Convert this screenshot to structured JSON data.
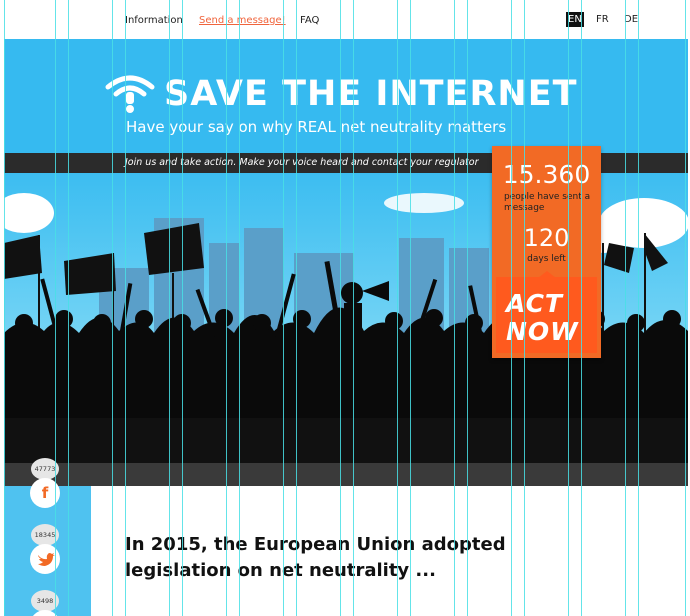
{
  "nav": {
    "info": "Information",
    "send": "Send a message!",
    "faq": "FAQ",
    "languages": [
      "EN",
      "FR",
      "DE"
    ]
  },
  "hero": {
    "title": "SAVE THE INTERNET",
    "subtitle": "Have your say on why REAL net neutrality matters",
    "strip": "Join us and take action. Make your voice heard and contact your regulator"
  },
  "counter": {
    "messages": "15.360",
    "messages_label": "people have sent a message",
    "days": "120",
    "days_label": "days left",
    "act_line1": "ACT",
    "act_line2": "NOW"
  },
  "share": [
    {
      "count": "47773",
      "icon": "facebook-icon",
      "letter": "f"
    },
    {
      "count": "18345",
      "icon": "twitter-icon"
    },
    {
      "count": "3498",
      "icon": "share-icon"
    }
  ],
  "content": {
    "headline": "In 2015, the European Union adopted legislation on net neutrality ..."
  },
  "colors": {
    "sky": "#36baf0",
    "accent": "#f26a25",
    "link": "#f0643c",
    "strip": "#2b2b2b",
    "facebook": "#f26a25",
    "twitter": "#f26a25"
  }
}
